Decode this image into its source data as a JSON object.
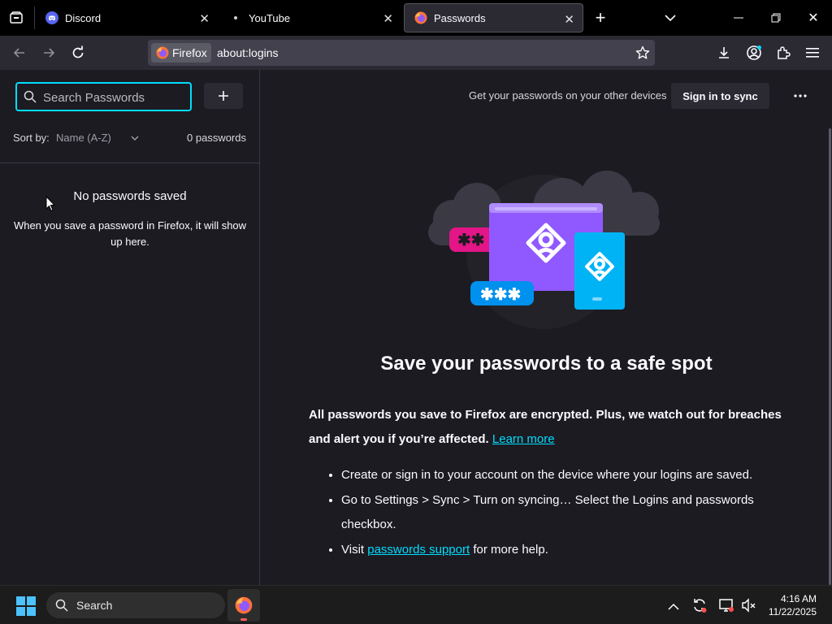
{
  "tabs": [
    {
      "title": "Discord",
      "icon": "discord-icon"
    },
    {
      "title": "YouTube",
      "icon": "youtube-icon"
    },
    {
      "title": "Passwords",
      "icon": "firefox-icon",
      "active": true
    }
  ],
  "urlbar": {
    "identity_label": "Firefox",
    "url": "about:logins"
  },
  "sidebar": {
    "search_placeholder": "Search Passwords",
    "sort_label": "Sort by:",
    "sort_value": "Name (A-Z)",
    "count_label": "0 passwords",
    "empty_title": "No passwords saved",
    "empty_desc": "When you save a password in Firefox, it will show up here."
  },
  "main": {
    "sync_prompt": "Get your passwords on your other devices",
    "sync_button": "Sign in to sync",
    "headline": "Save your passwords to a safe spot",
    "intro": "All passwords you save to Firefox are encrypted. Plus, we watch out for breaches and alert you if you’re affected.",
    "learn_more": "Learn more",
    "step1": "Create or sign in to your account on the device where your logins are saved.",
    "step2": "Go to Settings > Sync > Turn on syncing… Select the Logins and passwords checkbox.",
    "step3_pre": "Visit",
    "step3_link": "passwords support",
    "step3_post": "for more help."
  },
  "taskbar": {
    "search_label": "Search",
    "time": "4:16 AM",
    "date": "11/22/2025"
  },
  "colors": {
    "accent": "#00ddff",
    "bg": "#1c1b22",
    "chrome": "#2b2a33"
  }
}
